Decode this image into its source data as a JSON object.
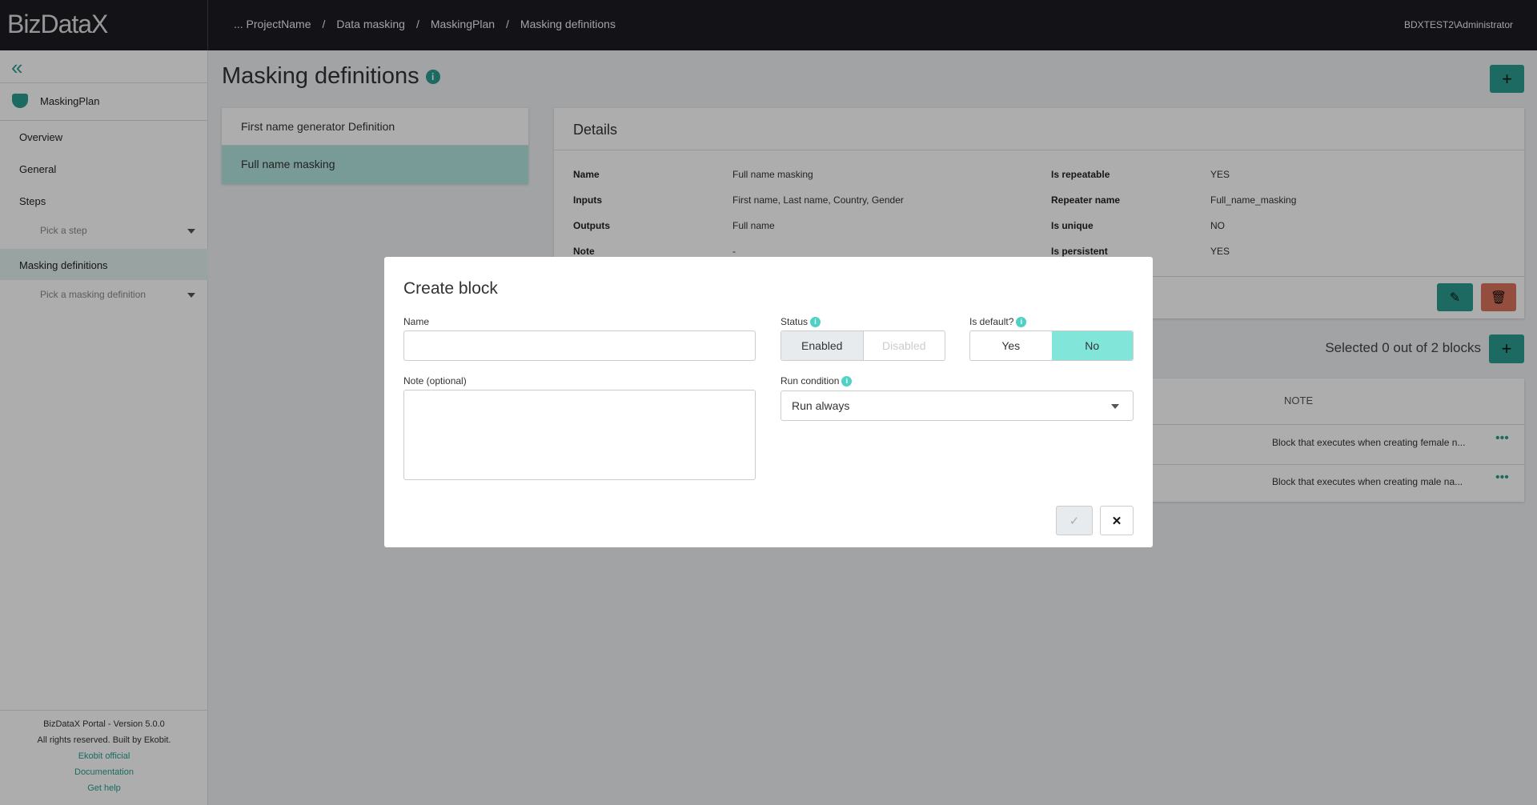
{
  "app": {
    "logo": "BizDataX",
    "user": "BDXTEST2\\Administrator"
  },
  "breadcrumb": [
    "... ProjectName",
    "Data masking",
    "MaskingPlan",
    "Masking definitions"
  ],
  "sidebar": {
    "plan": "MaskingPlan",
    "items": [
      "Overview",
      "General",
      "Steps",
      "Masking definitions"
    ],
    "step_placeholder": "Pick a step",
    "def_placeholder": "Pick a masking definition",
    "footer": {
      "version": "BizDataX Portal - Version 5.0.0",
      "rights": "All rights reserved. Built by Ekobit.",
      "links": [
        "Ekobit official",
        "Documentation",
        "Get help"
      ]
    }
  },
  "page": {
    "title": "Masking definitions"
  },
  "definitions": [
    "First name generator Definition",
    "Full name masking"
  ],
  "details": {
    "title": "Details",
    "rows": [
      {
        "label": "Name",
        "value": "Full name masking",
        "label2": "Is repeatable",
        "value2": "YES"
      },
      {
        "label": "Inputs",
        "value": "First name, Last name, Country, Gender",
        "label2": "Repeater name",
        "value2": "Full_name_masking"
      },
      {
        "label": "Outputs",
        "value": "Full name",
        "label2": "Is unique",
        "value2": "NO"
      },
      {
        "label": "Note",
        "value": "-",
        "label2": "Is persistent",
        "value2": "YES"
      }
    ]
  },
  "blocks": {
    "summary": "Selected 0 out of 2 blocks",
    "note_header": "NOTE",
    "rows": [
      "Block that executes when creating female n...",
      "Block that executes when creating male na..."
    ]
  },
  "modal": {
    "title": "Create block",
    "name_label": "Name",
    "name_value": "",
    "note_label": "Note (optional)",
    "status_label": "Status",
    "status_options": [
      "Enabled",
      "Disabled"
    ],
    "status_selected": "Enabled",
    "default_label": "Is default?",
    "default_options": [
      "Yes",
      "No"
    ],
    "default_selected": "No",
    "run_label": "Run condition",
    "run_value": "Run always"
  },
  "colors": {
    "accent": "#2a9d8f",
    "danger": "#c0604a",
    "toggle_active": "#81e6d9"
  }
}
